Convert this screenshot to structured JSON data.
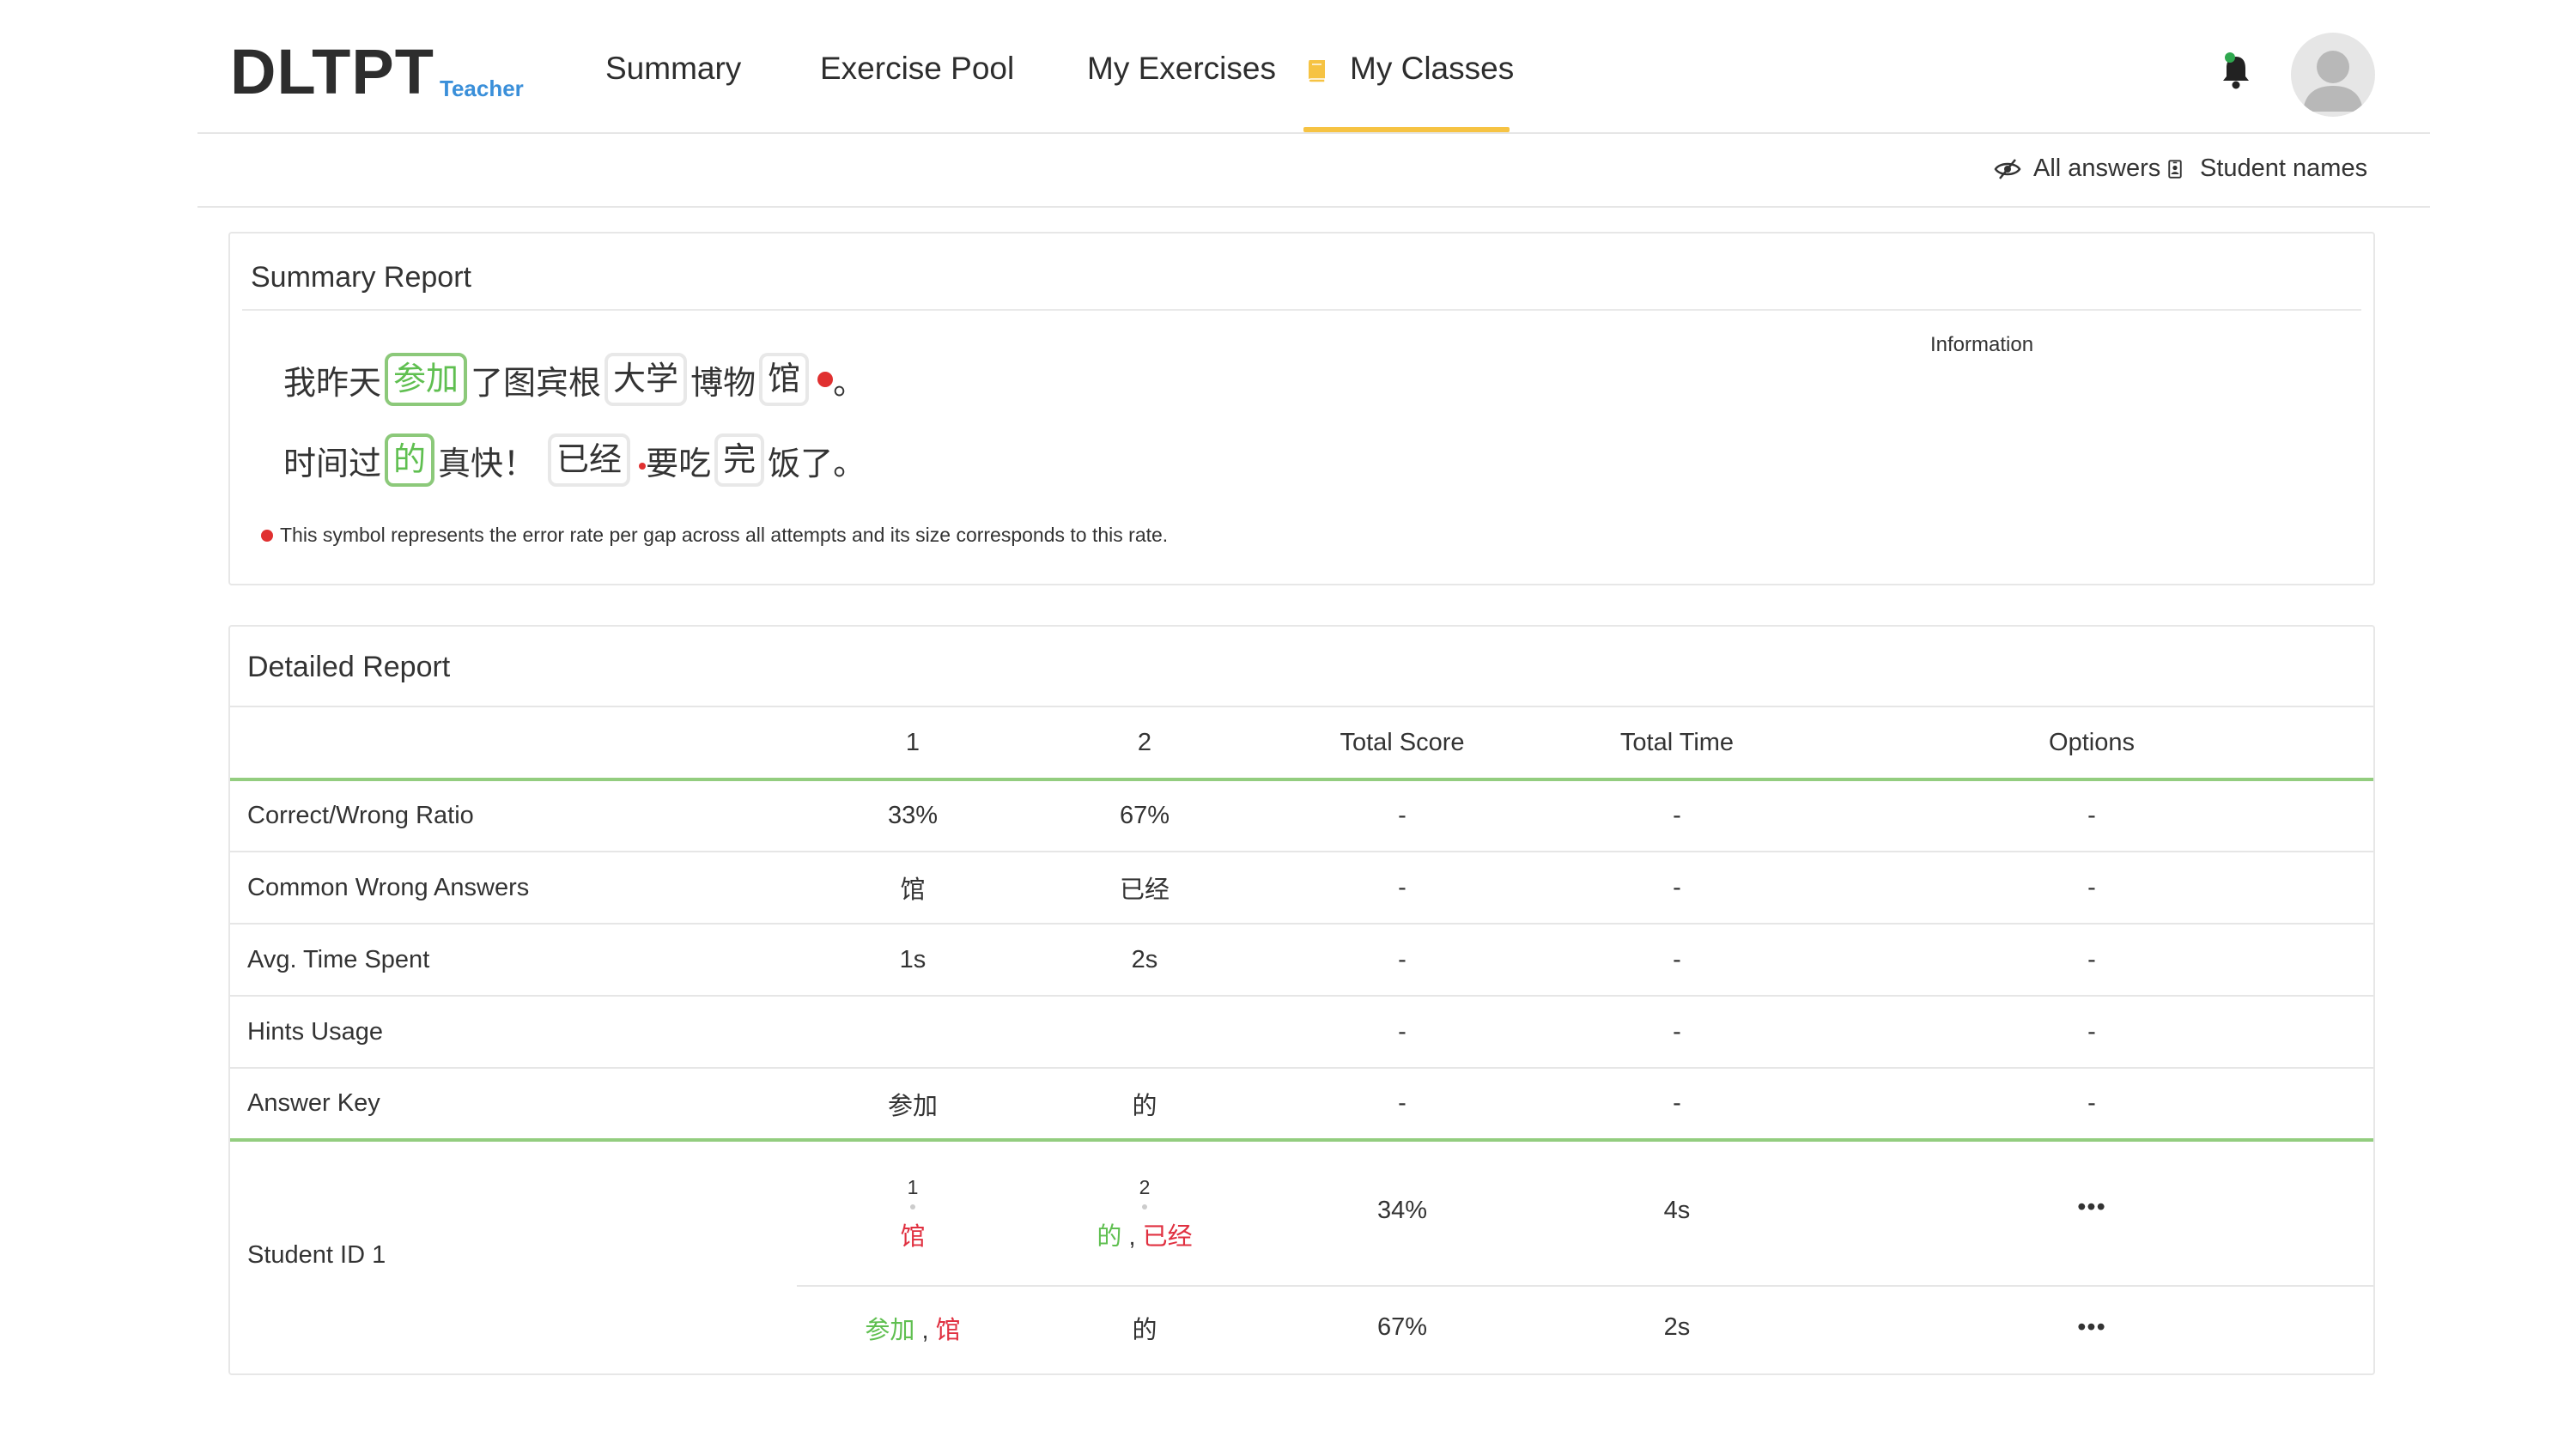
{
  "brand": {
    "name": "DLTPT",
    "role": "Teacher"
  },
  "nav": {
    "items": [
      {
        "label": "Summary"
      },
      {
        "label": "Exercise Pool"
      },
      {
        "label": "My Exercises"
      },
      {
        "label": "My Classes",
        "active": true
      }
    ]
  },
  "toolbar": {
    "all_answers": "All answers",
    "student_names": "Student names"
  },
  "summary": {
    "title": "Summary Report",
    "info_label": "Information",
    "sentence1": {
      "t1": "我昨天",
      "g1": "参加",
      "t2": "了图宾根",
      "g2": "大学",
      "t3": "博物",
      "g3": "馆",
      "t4": "。"
    },
    "sentence2": {
      "t1": "时间过",
      "g1": "的",
      "t2": "真快！",
      "g2": "已经",
      "t3": "要吃",
      "g3": "完",
      "t4": "饭了。"
    },
    "legend": "This symbol represents the error rate per gap across all attempts and its size corresponds to this rate."
  },
  "detail": {
    "title": "Detailed Report",
    "columns": [
      "",
      "1",
      "2",
      "Total Score",
      "Total Time",
      "Options"
    ],
    "rows": [
      {
        "label": "Correct/Wrong Ratio",
        "g1": "33%",
        "g2": "67%",
        "score": "-",
        "time": "-",
        "options": "-"
      },
      {
        "label": "Common Wrong Answers",
        "g1": "馆",
        "g2": "已经",
        "score": "-",
        "time": "-",
        "options": "-"
      },
      {
        "label": "Avg. Time Spent",
        "g1": "1s",
        "g2": "2s",
        "score": "-",
        "time": "-",
        "options": "-"
      },
      {
        "label": "Hints Usage",
        "g1": "",
        "g2": "",
        "score": "-",
        "time": "-",
        "options": "-"
      },
      {
        "label": "Answer Key",
        "g1": "参加",
        "g2": "的",
        "score": "-",
        "time": "-",
        "options": "-"
      }
    ],
    "student": {
      "label": "Student ID 1",
      "attempt1": {
        "g1_num": "1",
        "g2_num": "2",
        "g1_answer": "馆",
        "g2_answer_a": "的",
        "g2_sep": " , ",
        "g2_answer_b": "已经",
        "score": "34%",
        "time": "4s",
        "options": "•••"
      },
      "attempt2": {
        "g1_answer_a": "参加",
        "g1_sep": " , ",
        "g1_answer_b": "馆",
        "g2_answer": "的",
        "score": "67%",
        "time": "2s",
        "options": "•••"
      }
    }
  },
  "colors": {
    "accent": "#f6c343",
    "correct": "#5fbf50",
    "wrong": "#e03040",
    "link": "#3a8fd9",
    "table_rule": "#93cd7f"
  }
}
